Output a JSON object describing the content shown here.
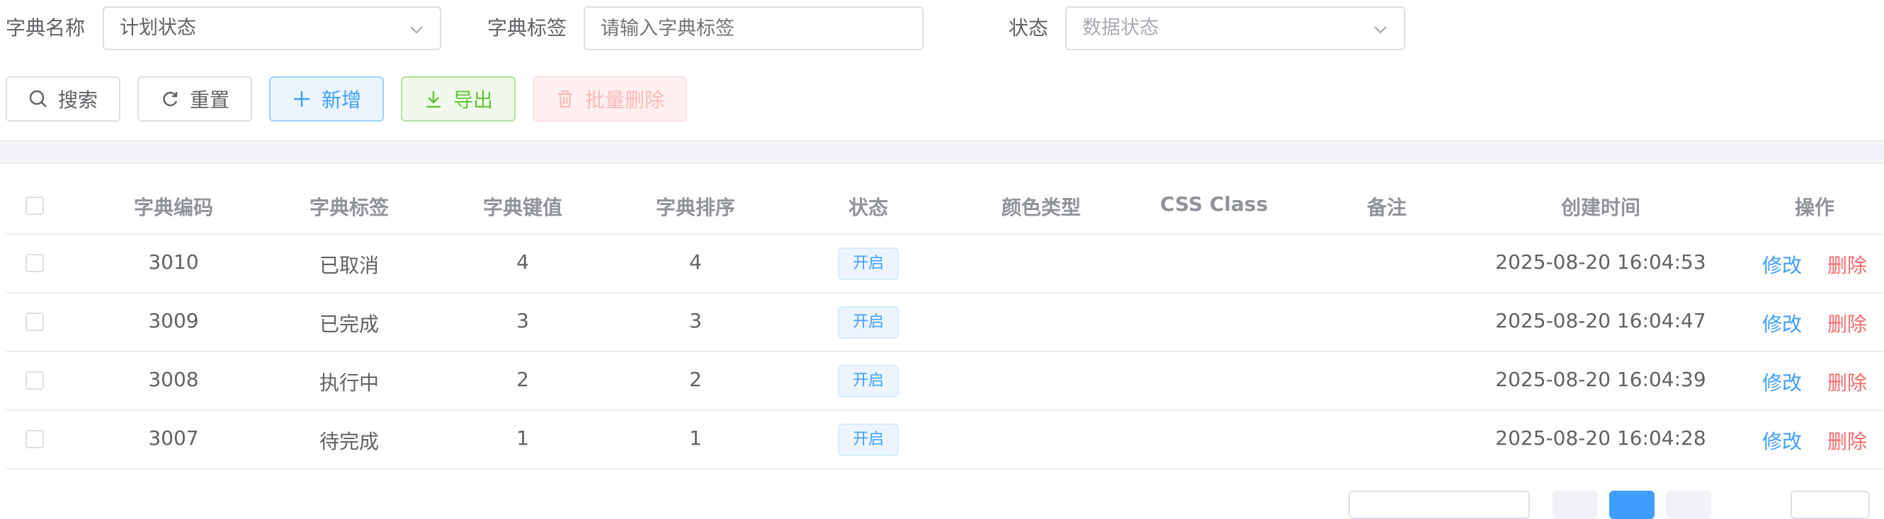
{
  "filters": {
    "dict_name": {
      "label": "字典名称",
      "value": "计划状态"
    },
    "dict_label": {
      "label": "字典标签",
      "placeholder": "请输入字典标签"
    },
    "status": {
      "label": "状态",
      "placeholder": "数据状态"
    }
  },
  "toolbar": {
    "search": "搜索",
    "reset": "重置",
    "add": "新增",
    "export": "导出",
    "batch_delete": "批量删除"
  },
  "table": {
    "headers": {
      "code": "字典编码",
      "label": "字典标签",
      "value": "字典键值",
      "sort": "字典排序",
      "status": "状态",
      "color": "颜色类型",
      "css": "CSS Class",
      "remark": "备注",
      "created": "创建时间",
      "actions": "操作"
    },
    "rows": [
      {
        "code": "3010",
        "label": "已取消",
        "value": "4",
        "sort": "4",
        "status": "开启",
        "created": "2025-08-20 16:04:53",
        "edit": "修改",
        "delete": "删除"
      },
      {
        "code": "3009",
        "label": "已完成",
        "value": "3",
        "sort": "3",
        "status": "开启",
        "created": "2025-08-20 16:04:47",
        "edit": "修改",
        "delete": "删除"
      },
      {
        "code": "3008",
        "label": "执行中",
        "value": "2",
        "sort": "2",
        "status": "开启",
        "created": "2025-08-20 16:04:39",
        "edit": "修改",
        "delete": "删除"
      },
      {
        "code": "3007",
        "label": "待完成",
        "value": "1",
        "sort": "1",
        "status": "开启",
        "created": "2025-08-20 16:04:28",
        "edit": "修改",
        "delete": "删除"
      }
    ]
  },
  "icons": {
    "search": "search-icon",
    "reset": "refresh-icon",
    "add": "plus-icon",
    "export": "download-icon",
    "batch_delete": "trash-icon",
    "select": "chevron-down-icon"
  },
  "colors": {
    "primary": "#409eff",
    "success": "#67c23a",
    "danger": "#f56c6c"
  }
}
